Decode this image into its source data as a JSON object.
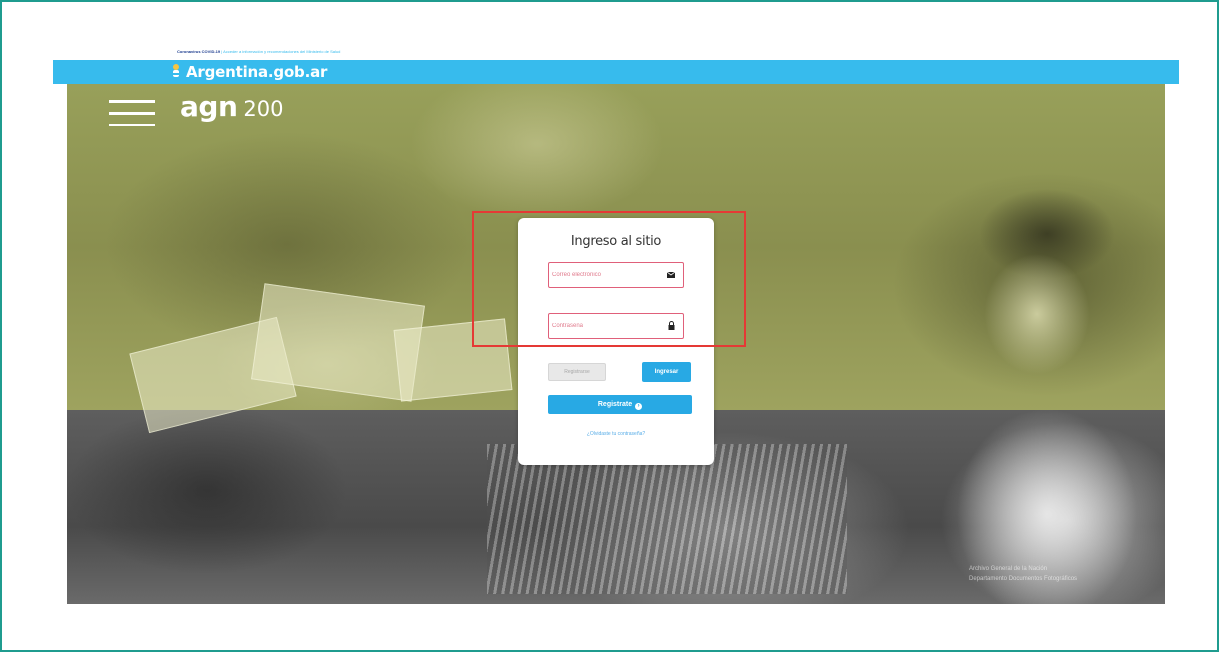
{
  "covid_bar": {
    "strong": "Coronavirus COVID-19",
    "text": "| Acceder a información y recomendaciones del Ministerio de Salud"
  },
  "gov_bar": {
    "brand": "Argentina.gob.ar",
    "icon": "argentina-shield-icon"
  },
  "header": {
    "logo_agn": "agn",
    "logo_num": "200",
    "menu_icon": "hamburger-menu-icon"
  },
  "login": {
    "title": "Ingreso al sitio",
    "email_placeholder": "Correo electrónico",
    "email_icon": "envelope-icon",
    "password_placeholder": "Contraseña",
    "password_icon": "lock-icon",
    "register_small_label": "Registrarse",
    "login_label": "Ingresar",
    "signup_label": "Registrate",
    "signup_icon": "arrow-right-circle-icon",
    "forgot_label": "¿Olvidaste tu contraseña?"
  },
  "hero": {
    "credit_line1": "Archivo General de la Nación",
    "credit_line2": "Departamento Documentos Fotográficos"
  },
  "colors": {
    "frame_border": "#1f9c8f",
    "gov_bar": "#37bbed",
    "button_blue": "#28a9e4",
    "field_border": "#e0607a",
    "highlight": "#e53935",
    "olive_overlay": "#98a05a"
  }
}
